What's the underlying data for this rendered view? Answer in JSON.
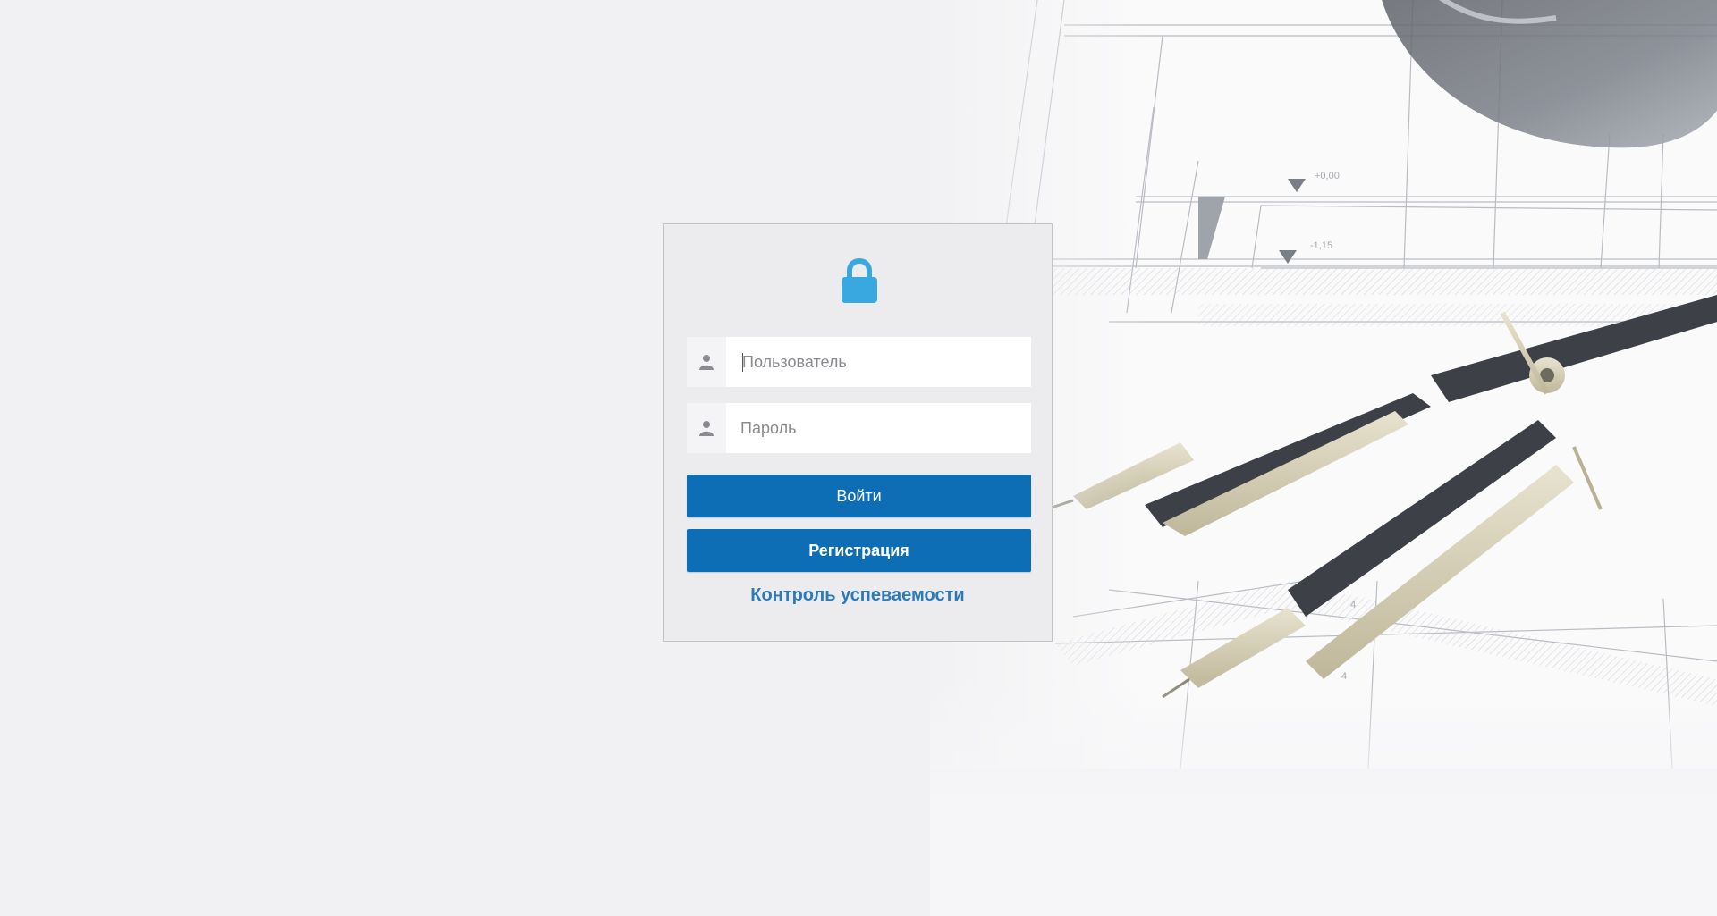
{
  "login": {
    "username_placeholder": "Пользователь",
    "password_placeholder": "Пароль",
    "login_button": "Войти",
    "register_button": "Регистрация",
    "progress_link": "Контроль успеваемости"
  },
  "icons": {
    "lock": "lock-icon",
    "username": "user-icon",
    "password": "user-icon"
  },
  "colors": {
    "accent": "#0d6eb6",
    "lock": "#3aa8e0",
    "link": "#2d7ab8",
    "background": "#f1f1f3"
  }
}
